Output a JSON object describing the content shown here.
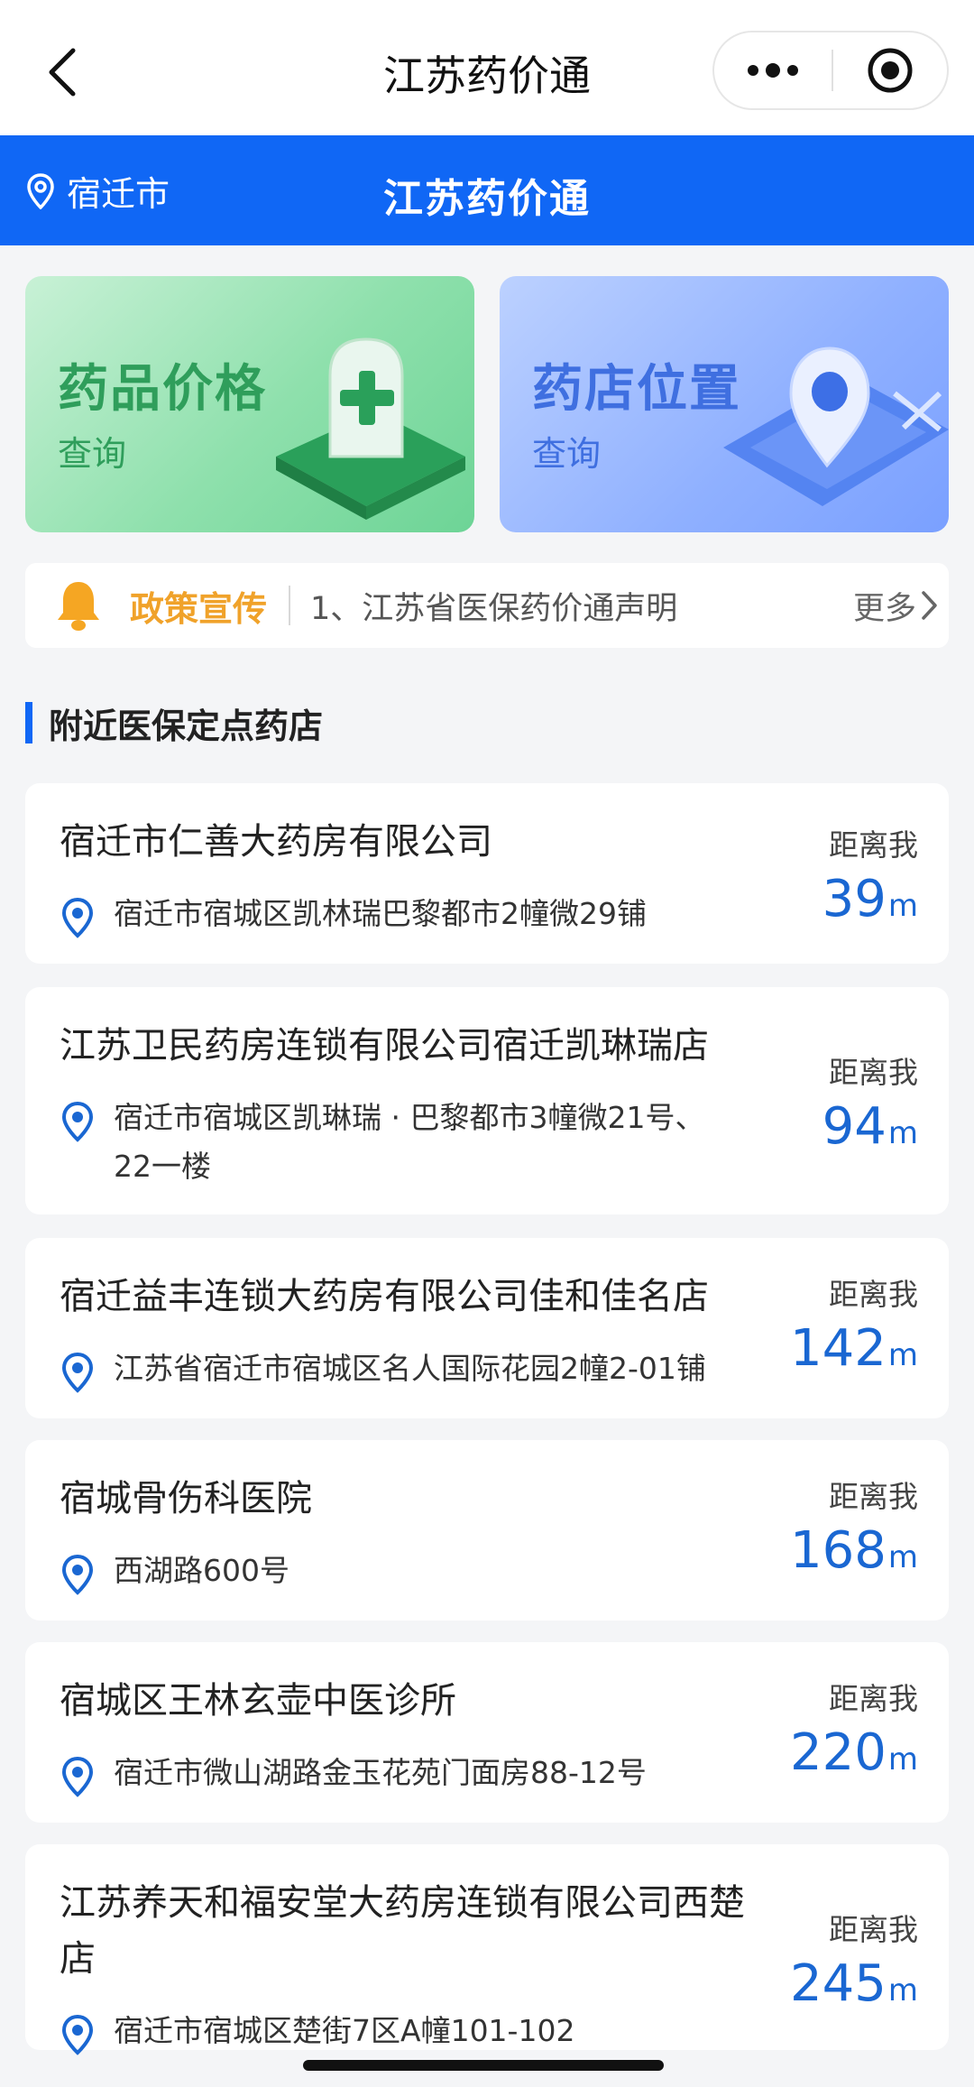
{
  "navbar": {
    "title": "江苏药价通"
  },
  "header": {
    "city": "宿迁市",
    "title": "江苏药价通"
  },
  "features": [
    {
      "title": "药品价格",
      "subtitle": "查询"
    },
    {
      "title": "药店位置",
      "subtitle": "查询"
    }
  ],
  "notice": {
    "tag": "政策宣传",
    "text": "1、江苏省医保药价通声明",
    "more": "更多"
  },
  "section": {
    "title": "附近医保定点药店"
  },
  "stores": [
    {
      "name": "宿迁市仁善大药房有限公司",
      "address": "宿迁市宿城区凯林瑞巴黎都市2幢微29铺",
      "distance_label": "距离我",
      "distance": "39",
      "unit": "m"
    },
    {
      "name": "江苏卫民药房连锁有限公司宿迁凯琳瑞店",
      "address": "宿迁市宿城区凯琳瑞 · 巴黎都市3幢微21号、22一楼",
      "distance_label": "距离我",
      "distance": "94",
      "unit": "m"
    },
    {
      "name": "宿迁益丰连锁大药房有限公司佳和佳名店",
      "address": "江苏省宿迁市宿城区名人国际花园2幢2-01铺",
      "distance_label": "距离我",
      "distance": "142",
      "unit": "m"
    },
    {
      "name": "宿城骨伤科医院",
      "address": "西湖路600号",
      "distance_label": "距离我",
      "distance": "168",
      "unit": "m"
    },
    {
      "name": "宿城区王林玄壶中医诊所",
      "address": "宿迁市微山湖路金玉花苑门面房88-12号",
      "distance_label": "距离我",
      "distance": "220",
      "unit": "m"
    },
    {
      "name": "江苏养天和福安堂大药房连锁有限公司西楚店",
      "address": "宿迁市宿城区楚街7区A幢101-102",
      "distance_label": "距离我",
      "distance": "245",
      "unit": "m"
    }
  ],
  "colors": {
    "primary": "#1067f5",
    "distance": "#1a67d2",
    "notice_tag": "#f0a22a"
  },
  "icons": [
    "back-arrow-icon",
    "more-dots-icon",
    "close-target-icon",
    "location-pin-icon",
    "bell-icon",
    "chevron-right-icon"
  ]
}
